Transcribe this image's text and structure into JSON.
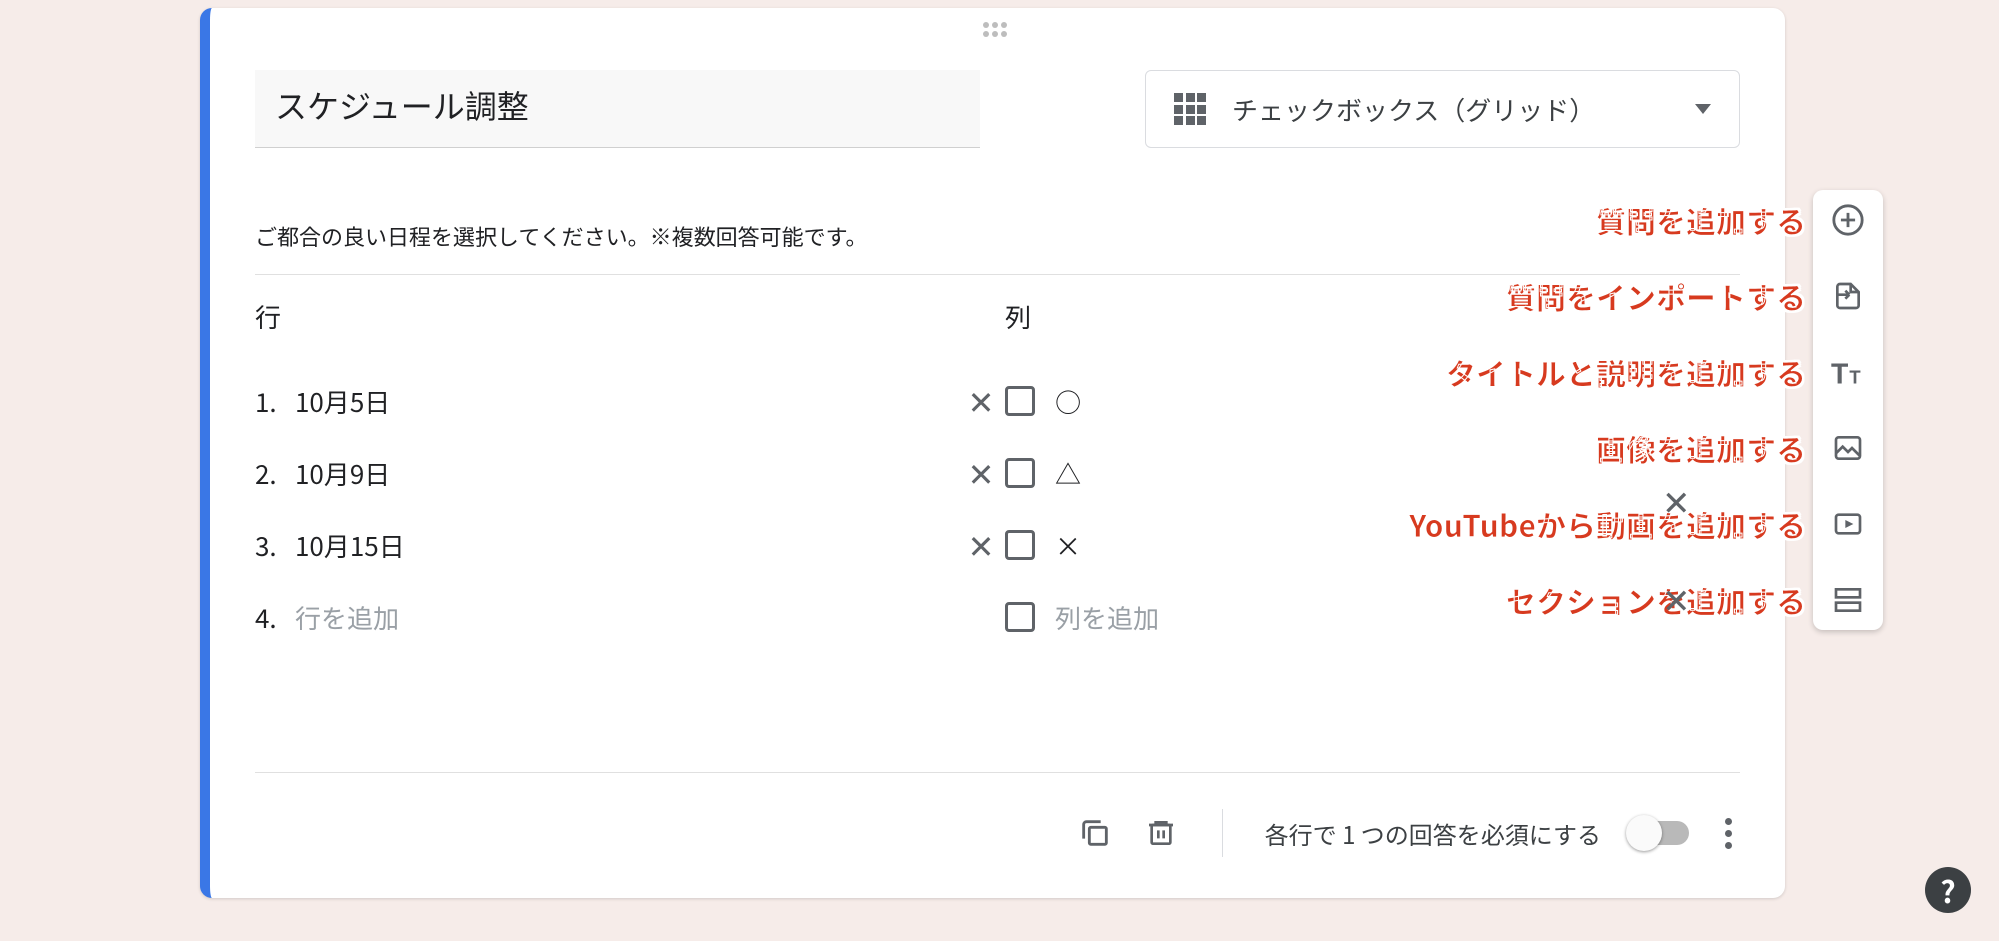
{
  "question": {
    "title": "スケジュール調整",
    "description": "ご都合の良い日程を選択してください。※複数回答可能です。",
    "type_label": "チェックボックス（グリッド）"
  },
  "grid": {
    "row_header": "行",
    "col_header": "列",
    "rows": [
      "10月5日",
      "10月9日",
      "10月15日"
    ],
    "cols": [
      "○",
      "△",
      "×"
    ],
    "add_row_label": "行を追加",
    "add_col_label": "列を追加",
    "add_row_num": "4."
  },
  "footer": {
    "required_label": "各行で 1 つの回答を必須にする"
  },
  "side_toolbar": [
    "質問を追加する",
    "質問をインポートする",
    "タイトルと説明を追加する",
    "画像を追加する",
    "YouTubeから動画を追加する",
    "セクションを追加する"
  ]
}
